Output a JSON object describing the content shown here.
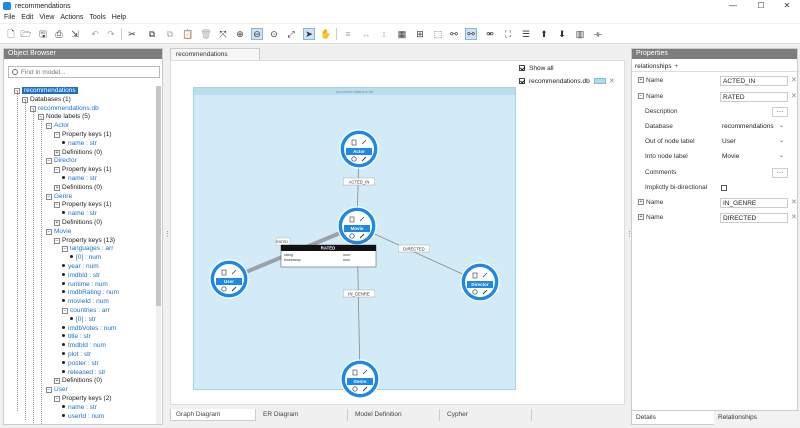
{
  "window": {
    "title": "recommendations",
    "minimize": "—",
    "maximize": "☐",
    "close": "✕"
  },
  "menu": [
    "File",
    "Edit",
    "View",
    "Actions",
    "Tools",
    "Help"
  ],
  "object_browser": {
    "header": "Object Browser",
    "search_placeholder": "Find in model...",
    "tree": [
      {
        "label": "recommendations",
        "level": 0,
        "exp": "−",
        "style": "sel"
      },
      {
        "label": "Databases (1)",
        "level": 1,
        "exp": "−"
      },
      {
        "label": "recommendations.db",
        "level": 2,
        "exp": "−",
        "style": "blue"
      },
      {
        "label": "Node labels (5)",
        "level": 3,
        "exp": "−"
      },
      {
        "label": "Actor",
        "level": 4,
        "exp": "−",
        "style": "blue"
      },
      {
        "label": "Property keys (1)",
        "level": 5,
        "exp": "−"
      },
      {
        "label": "name : str",
        "level": 6,
        "dot": true,
        "style": "blue"
      },
      {
        "label": "Definitions (0)",
        "level": 5,
        "exp": "+"
      },
      {
        "label": "Director",
        "level": 4,
        "exp": "−",
        "style": "blue"
      },
      {
        "label": "Property keys (1)",
        "level": 5,
        "exp": "−"
      },
      {
        "label": "name : str",
        "level": 6,
        "dot": true,
        "style": "blue"
      },
      {
        "label": "Definitions (0)",
        "level": 5,
        "exp": "+"
      },
      {
        "label": "Genre",
        "level": 4,
        "exp": "−",
        "style": "blue"
      },
      {
        "label": "Property keys (1)",
        "level": 5,
        "exp": "−"
      },
      {
        "label": "name : str",
        "level": 6,
        "dot": true,
        "style": "blue"
      },
      {
        "label": "Definitions (0)",
        "level": 5,
        "exp": "+"
      },
      {
        "label": "Movie",
        "level": 4,
        "exp": "−",
        "style": "blue"
      },
      {
        "label": "Property keys (13)",
        "level": 5,
        "exp": "−"
      },
      {
        "label": "languages : arr",
        "level": 6,
        "exp": "−",
        "style": "blue"
      },
      {
        "label": "[0] : num",
        "level": 7,
        "dot": true,
        "style": "blue"
      },
      {
        "label": "year : num",
        "level": 6,
        "dot": true,
        "style": "blue"
      },
      {
        "label": "imdbId : str",
        "level": 6,
        "dot": true,
        "style": "blue"
      },
      {
        "label": "runtime : num",
        "level": 6,
        "dot": true,
        "style": "blue"
      },
      {
        "label": "imdbRating : num",
        "level": 6,
        "dot": true,
        "style": "blue"
      },
      {
        "label": "movieId : num",
        "level": 6,
        "dot": true,
        "style": "blue"
      },
      {
        "label": "countries : arr",
        "level": 6,
        "exp": "−",
        "style": "blue"
      },
      {
        "label": "[0] : str",
        "level": 7,
        "dot": true,
        "style": "blue"
      },
      {
        "label": "imdbVotes : num",
        "level": 6,
        "dot": true,
        "style": "blue"
      },
      {
        "label": "title : str",
        "level": 6,
        "dot": true,
        "style": "blue"
      },
      {
        "label": "tmdbId : num",
        "level": 6,
        "dot": true,
        "style": "blue"
      },
      {
        "label": "plot : str",
        "level": 6,
        "dot": true,
        "style": "blue"
      },
      {
        "label": "poster : str",
        "level": 6,
        "dot": true,
        "style": "blue"
      },
      {
        "label": "released : str",
        "level": 6,
        "dot": true,
        "style": "blue"
      },
      {
        "label": "Definitions (0)",
        "level": 5,
        "exp": "+"
      },
      {
        "label": "User",
        "level": 4,
        "exp": "−",
        "style": "blue"
      },
      {
        "label": "Property keys (2)",
        "level": 5,
        "exp": "−"
      },
      {
        "label": "name : str",
        "level": 6,
        "dot": true,
        "style": "blue"
      },
      {
        "label": "userId : num",
        "level": 6,
        "dot": true,
        "style": "blue"
      }
    ]
  },
  "canvas": {
    "tab": "recommendations",
    "diagram_caption": "recommendations.db",
    "show_all_label": "Show all",
    "db_label": "recommendations.db",
    "nodes": [
      {
        "id": "actor",
        "label": "Actor"
      },
      {
        "id": "movie",
        "label": "Movie"
      },
      {
        "id": "user",
        "label": "User"
      },
      {
        "id": "director",
        "label": "Director"
      },
      {
        "id": "genre",
        "label": "Genre"
      }
    ],
    "edges": [
      {
        "label": "ACTED_IN"
      },
      {
        "label": "RATED"
      },
      {
        "label": "DIRECTED"
      },
      {
        "label": "IN_GENRE"
      }
    ],
    "rated_popup": {
      "title": "RATED",
      "rows": [
        {
          "name": "rating",
          "type": "num"
        },
        {
          "name": "timestamp",
          "type": "num"
        }
      ]
    },
    "bottom_tabs": [
      "Graph Diagram",
      "ER Diagram",
      "Model Definition",
      "Cypher"
    ]
  },
  "properties": {
    "header": "Properties",
    "sub_tab": "relationships",
    "sub_plus": "+",
    "rows": [
      {
        "type": "name",
        "exp": "+",
        "label": "Name",
        "value": "ACTED_IN"
      },
      {
        "type": "name",
        "exp": "−",
        "label": "Name",
        "value": "RATED"
      },
      {
        "type": "text",
        "label": "Description",
        "value": ""
      },
      {
        "type": "select",
        "label": "Database",
        "value": "recommendations"
      },
      {
        "type": "select",
        "label": "Out of node label",
        "value": "User"
      },
      {
        "type": "select",
        "label": "Into node label",
        "value": "Movie"
      },
      {
        "type": "text",
        "label": "Comments",
        "value": ""
      },
      {
        "type": "check",
        "label": "Implictly bi-directional"
      },
      {
        "type": "name",
        "exp": "+",
        "label": "Name",
        "value": "IN_GENRE"
      },
      {
        "type": "name",
        "exp": "+",
        "label": "Name",
        "value": "DIRECTED"
      }
    ],
    "tabs": [
      "Details",
      "Relationships"
    ]
  },
  "colors": {
    "node_fill": "#1e88e5",
    "diagram_bg": "#d2ebf6",
    "selection": "#1e6fc8"
  }
}
